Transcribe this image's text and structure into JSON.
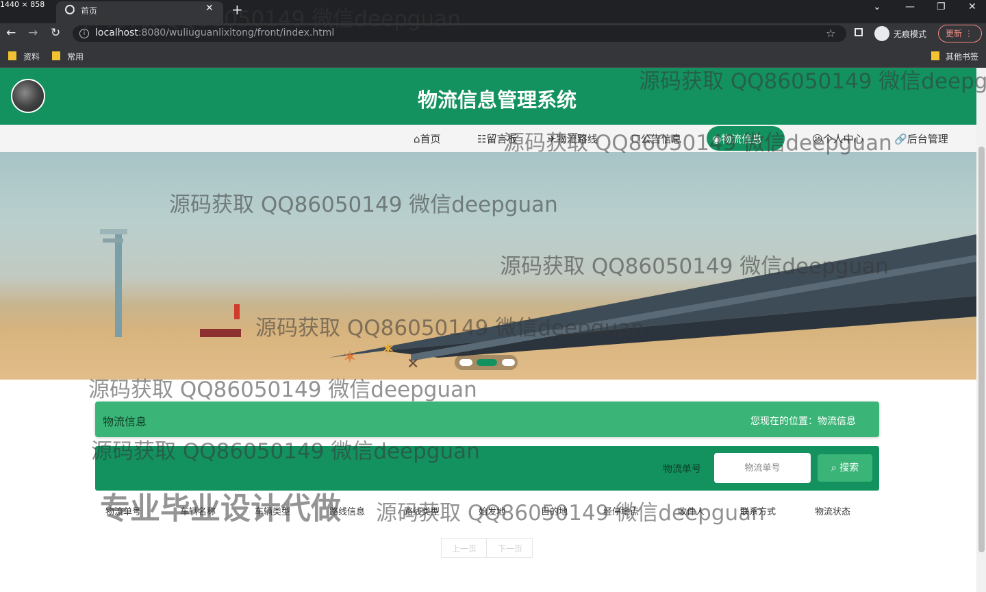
{
  "browser": {
    "dimensions_label": "1440 × 858",
    "tab_title": "首页",
    "url_host": "localhost",
    "url_path": ":8080/wuliuguanlixitong/front/index.html",
    "incognito_label": "无痕模式",
    "update_label": "更新",
    "bookmarks": [
      "资料",
      "常用"
    ],
    "other_bookmarks": "其他书签"
  },
  "site": {
    "title": "物流信息管理系统",
    "nav": [
      "首页",
      "留言板",
      "物流路线",
      "公告信息",
      "物流信息",
      "个人中心",
      "后台管理"
    ],
    "active_nav": "物流信息"
  },
  "breadcrumb": {
    "title": "物流信息",
    "location": "您现在的位置：物流信息"
  },
  "search": {
    "label": "物流单号",
    "placeholder": "物流单号",
    "button": "搜索"
  },
  "table": {
    "headers": [
      "物流单号",
      "车辆名称",
      "车辆类型",
      "路线信息",
      "路线类型",
      "始发地",
      "目的地",
      "经停地点",
      "收件人",
      "联系方式",
      "物流状态"
    ]
  },
  "pager": {
    "prev": "上一页",
    "next": "下一页"
  },
  "watermark": {
    "text": "源码获取 QQ86050149 微信deepguan",
    "big": "专业毕业设计代做"
  },
  "colors": {
    "primary": "#13925f",
    "accent": "#3bb577"
  }
}
